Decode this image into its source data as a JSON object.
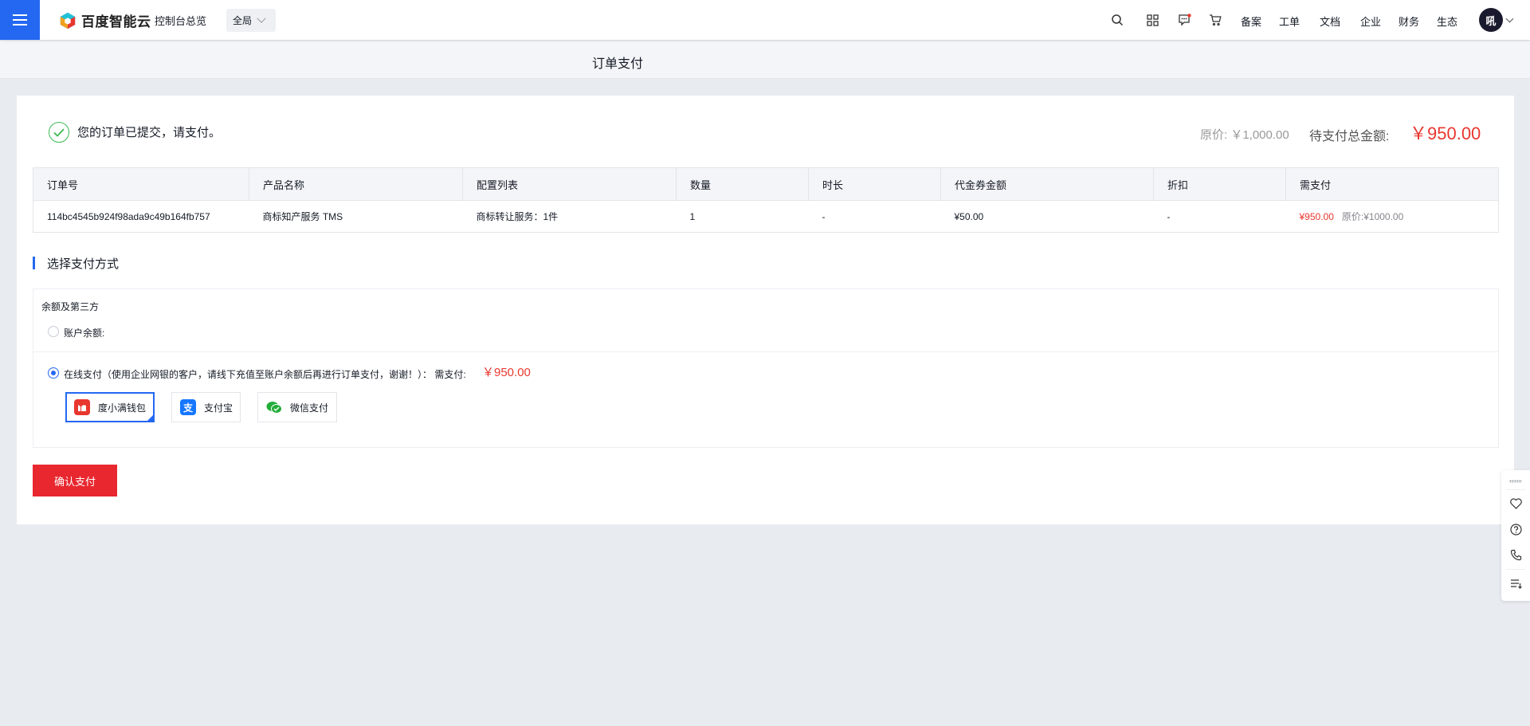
{
  "header": {
    "brand": "百度智能云",
    "console_link": "控制台总览",
    "region": "全局",
    "links": [
      "备案",
      "工单",
      "文档",
      "企业",
      "财务",
      "生态"
    ],
    "avatar_text": "吼"
  },
  "subbar": {
    "title": "订单支付"
  },
  "order": {
    "success_message": "您的订单已提交，请支付。",
    "original_price": "原价: ￥1,000.00",
    "total_label": "待支付总金额:",
    "total_amount": "￥950.00",
    "table": {
      "headers": [
        "订单号",
        "产品名称",
        "配置列表",
        "数量",
        "时长",
        "代金券金额",
        "折扣",
        "需支付"
      ],
      "row": {
        "order_id": "114bc4545b924f98ada9c49b164fb757",
        "product": "商标知产服务 TMS",
        "config": "商标转让服务：1件",
        "quantity": "1",
        "duration": "-",
        "voucher": "¥50.00",
        "discount": "-",
        "pay": "¥950.00",
        "pay_original": "原价:¥1000.00"
      }
    }
  },
  "payment": {
    "section_title": "选择支付方式",
    "group_title": "余额及第三方",
    "balance_label": "账户余额:",
    "online_label": "在线支付（使用企业网银的客户，请线下充值至账户余额后再进行订单支付，谢谢！）：  需支付:",
    "online_amount": "￥950.00",
    "options": [
      {
        "label": "度小满钱包",
        "selected": true,
        "color": "#e8372f"
      },
      {
        "label": "支付宝",
        "selected": false,
        "color": "#1677ff"
      },
      {
        "label": "微信支付",
        "selected": false,
        "color": "#22ac38"
      }
    ],
    "confirm_label": "确认支付"
  },
  "colors": {
    "accent": "#2468f2",
    "price_red": "#e8372f",
    "success_green": "#3cba52"
  }
}
